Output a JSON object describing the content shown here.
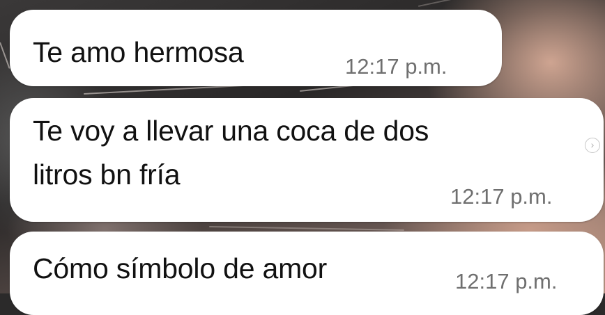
{
  "chat": {
    "messages": [
      {
        "text": "Te amo hermosa",
        "time": "12:17 p.m."
      },
      {
        "text": "Te voy a llevar una coca de dos\nlitros bn fría",
        "time": "12:17 p.m."
      },
      {
        "text": "Cómo símbolo de amor",
        "time": "12:17 p.m."
      }
    ]
  },
  "icons": {
    "scroll_indicator": "chevron-right-icon"
  },
  "colors": {
    "bubble": "#ffffff",
    "text": "#111111",
    "timestamp": "#6f6f6f"
  }
}
